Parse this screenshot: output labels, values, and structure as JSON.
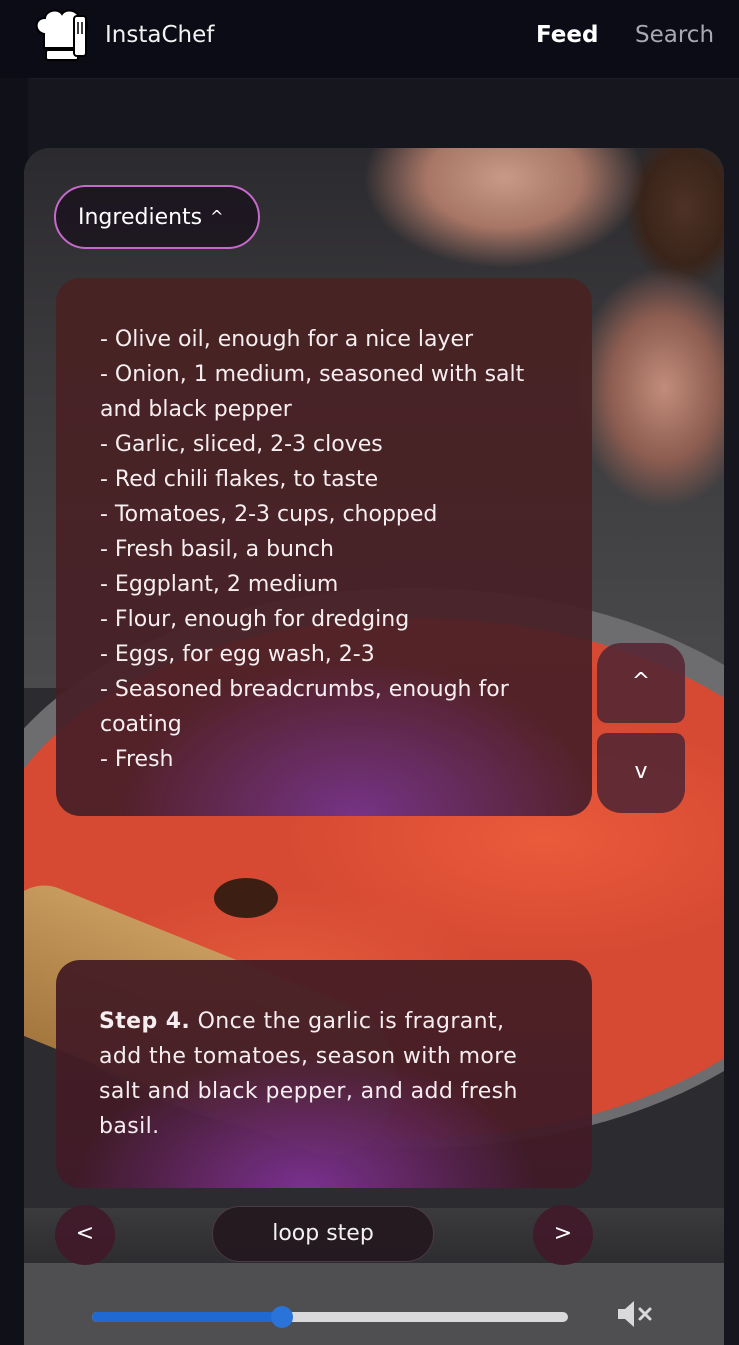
{
  "header": {
    "brand": "InstaChef",
    "nav": {
      "feed": "Feed",
      "search": "Search"
    }
  },
  "ingredients": {
    "toggle_label": "Ingredients",
    "items": [
      "- Olive oil, enough for a nice layer",
      "- Onion, 1 medium, seasoned with salt and black pepper",
      "- Garlic, sliced, 2-3 cloves",
      "- Red chili flakes, to taste",
      "- Tomatoes, 2-3 cups, chopped",
      "- Fresh basil, a bunch",
      "- Eggplant, 2 medium",
      "- Flour, enough for dredging",
      "- Eggs, for egg wash, 2-3",
      "- Seasoned breadcrumbs, enough for coating",
      "- Fresh"
    ]
  },
  "scroll": {
    "up": "^",
    "down": "v"
  },
  "step": {
    "label": "Step 4.",
    "text": "Once the garlic is fragrant, add the tomatoes, season with more salt and black pepper, and add fresh basil."
  },
  "controls": {
    "prev": "<",
    "next": ">",
    "loop": "loop step"
  },
  "player": {
    "progress": 0.4,
    "muted": true
  },
  "colors": {
    "accent": "#1f6ad2",
    "toggle_border": "#c56acb"
  },
  "icons": [
    "chef-hat-logo-icon",
    "chevron-up-icon",
    "mute-icon"
  ]
}
